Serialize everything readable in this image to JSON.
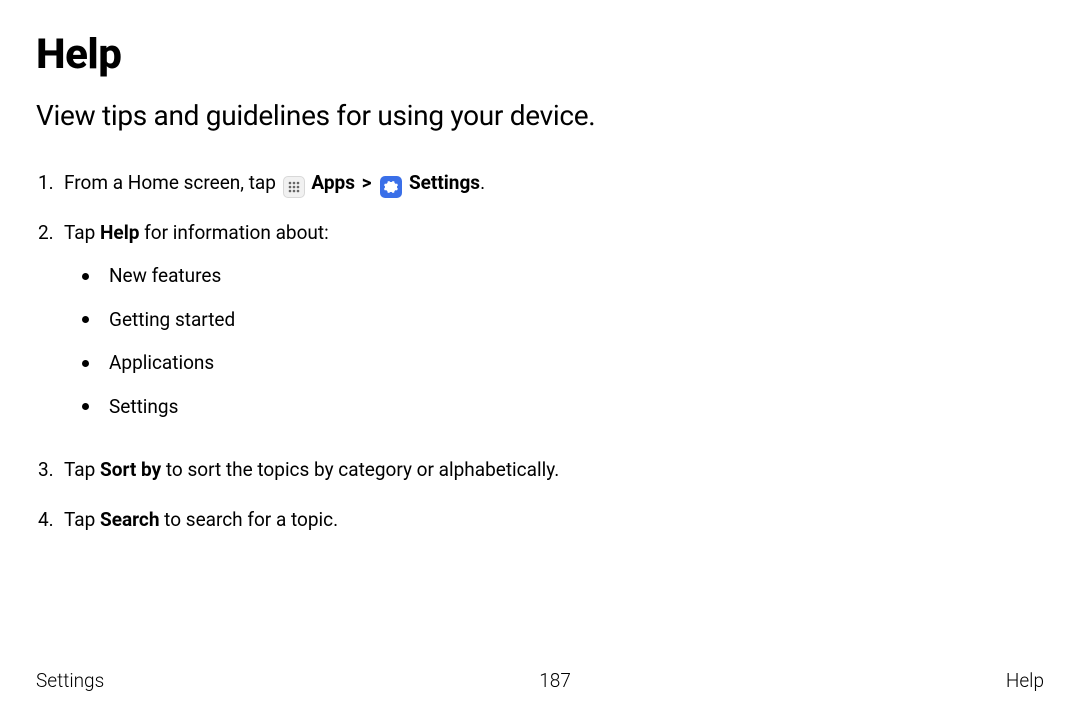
{
  "title": "Help",
  "subtitle": "View tips and guidelines for using your device.",
  "step1": {
    "num": "1.",
    "text_a": "From a Home screen, tap ",
    "apps_label": "Apps",
    "sep": " > ",
    "settings_label": "Settings",
    "period": "."
  },
  "step2": {
    "num": "2.",
    "text_a": "Tap ",
    "bold": "Help",
    "text_b": " for information about:",
    "bullets": [
      "New features",
      "Getting started",
      "Applications",
      "Settings"
    ]
  },
  "step3": {
    "num": "3.",
    "text_a": "Tap ",
    "bold": "Sort by",
    "text_b": " to sort the topics by category or alphabetically."
  },
  "step4": {
    "num": "4.",
    "text_a": "Tap ",
    "bold": "Search",
    "text_b": " to search for a topic."
  },
  "footer": {
    "left": "Settings",
    "center": "187",
    "right": "Help"
  }
}
